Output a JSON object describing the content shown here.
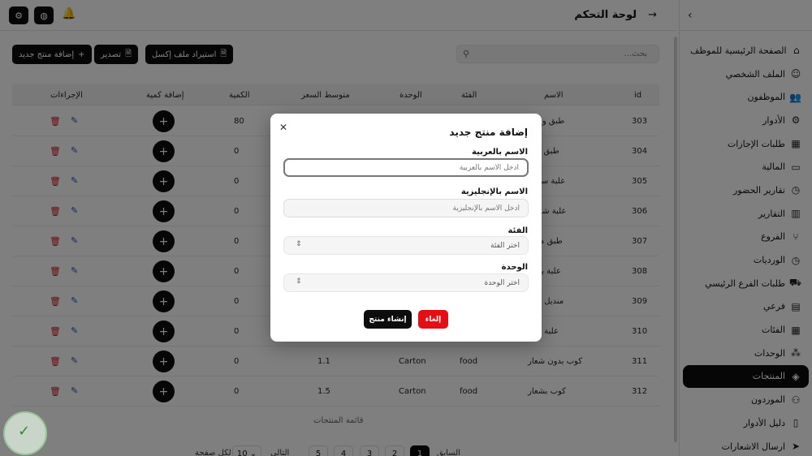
{
  "header": {
    "title": "لوحة التحكم",
    "back_icon": "arrow-right-icon",
    "settings_icon": "gear-icon",
    "globe_icon": "globe-icon",
    "bell_icon": "bell-icon"
  },
  "sidebar": {
    "toggle_icon": "chevron-left-icon",
    "items": [
      {
        "label": "الصفحة الرئيسية للموظف",
        "icon": "home-icon"
      },
      {
        "label": "الملف الشخصي",
        "icon": "user-icon"
      },
      {
        "label": "الموظفون",
        "icon": "users-icon"
      },
      {
        "label": "الأدوار",
        "icon": "user-cog-icon"
      },
      {
        "label": "طلبات الإجازات",
        "icon": "calendar-icon"
      },
      {
        "label": "المالية",
        "icon": "wallet-icon"
      },
      {
        "label": "تقارير الحضور",
        "icon": "clock-icon"
      },
      {
        "label": "التقارير",
        "icon": "chart-icon"
      },
      {
        "label": "الفروع",
        "icon": "branches-icon"
      },
      {
        "label": "الورديات",
        "icon": "clock-icon"
      },
      {
        "label": "طلبات الفرع الرئيسي",
        "icon": "truck-icon"
      },
      {
        "label": "فرعي",
        "icon": "building-icon"
      },
      {
        "label": "الفئات",
        "icon": "grid-icon"
      },
      {
        "label": "الوحدات",
        "icon": "units-icon"
      },
      {
        "label": "المنتجات",
        "icon": "box-icon",
        "active": true
      },
      {
        "label": "الموردون",
        "icon": "supplier-icon"
      },
      {
        "label": "دليل الأدوار",
        "icon": "book-icon"
      },
      {
        "label": "ارسال الاشعارات",
        "icon": "send-icon"
      }
    ]
  },
  "toolbar": {
    "add_label": "إضافة منتج جديد",
    "export_label": "تصدير",
    "import_label": "استيراد ملف إكسل",
    "search_placeholder": "بحث..."
  },
  "table": {
    "headers": {
      "id": "id",
      "name": "الاسم",
      "category": "الفئة",
      "unit": "الوحدة",
      "avg_price": "متوسط السعر",
      "qty": "الكمية",
      "add_qty": "إضافة كمية",
      "actions": "الإجراءات"
    },
    "rows": [
      {
        "id": "303",
        "name": "طبق وسط",
        "category": "",
        "unit": "",
        "avg_price": "",
        "qty": "80"
      },
      {
        "id": "304",
        "name": "طبق كبير",
        "category": "",
        "unit": "",
        "avg_price": "",
        "qty": "0"
      },
      {
        "id": "305",
        "name": "علبة سلطة",
        "category": "",
        "unit": "",
        "avg_price": "",
        "qty": "0"
      },
      {
        "id": "306",
        "name": "علبة شوربة",
        "category": "",
        "unit": "",
        "avg_price": "",
        "qty": "0"
      },
      {
        "id": "307",
        "name": "طبق مدور",
        "category": "",
        "unit": "",
        "avg_price": "",
        "qty": "0"
      },
      {
        "id": "308",
        "name": "علبة برجر",
        "category": "",
        "unit": "",
        "avg_price": "",
        "qty": "0"
      },
      {
        "id": "309",
        "name": "منديل بيتزا",
        "category": "",
        "unit": "",
        "avg_price": "",
        "qty": "0"
      },
      {
        "id": "310",
        "name": "علبة بيتزا",
        "category": "",
        "unit": "",
        "avg_price": "",
        "qty": "0"
      },
      {
        "id": "311",
        "name": "كوب بدون شعار",
        "category": "food",
        "unit": "Carton",
        "avg_price": "1.1",
        "qty": "0"
      },
      {
        "id": "312",
        "name": "كوب بشعار",
        "category": "food",
        "unit": "Carton",
        "avg_price": "1.5",
        "qty": "0"
      }
    ],
    "caption": "قائمة المنتجات"
  },
  "pagination": {
    "pages": [
      "1",
      "2",
      "3",
      "4",
      "5"
    ],
    "active_page": "1",
    "prev_label": "السابق",
    "next_label": "التالي",
    "page_size": "10",
    "per_page_label": "لكل صفحة"
  },
  "modal": {
    "title": "إضافة منتج جديد",
    "close_icon": "close-icon",
    "name_ar_label": "الاسم بالعربية",
    "name_ar_placeholder": "أدخل الاسم بالعربية",
    "name_en_label": "الاسم بالإنجليزية",
    "name_en_placeholder": "أدخل الاسم بالإنجليزية",
    "category_label": "الفئة",
    "category_value": "اختر الفئة",
    "unit_label": "الوحدة",
    "unit_value": "اختر الوحدة",
    "cancel_label": "إلغاء",
    "create_label": "إنشاء منتج"
  }
}
